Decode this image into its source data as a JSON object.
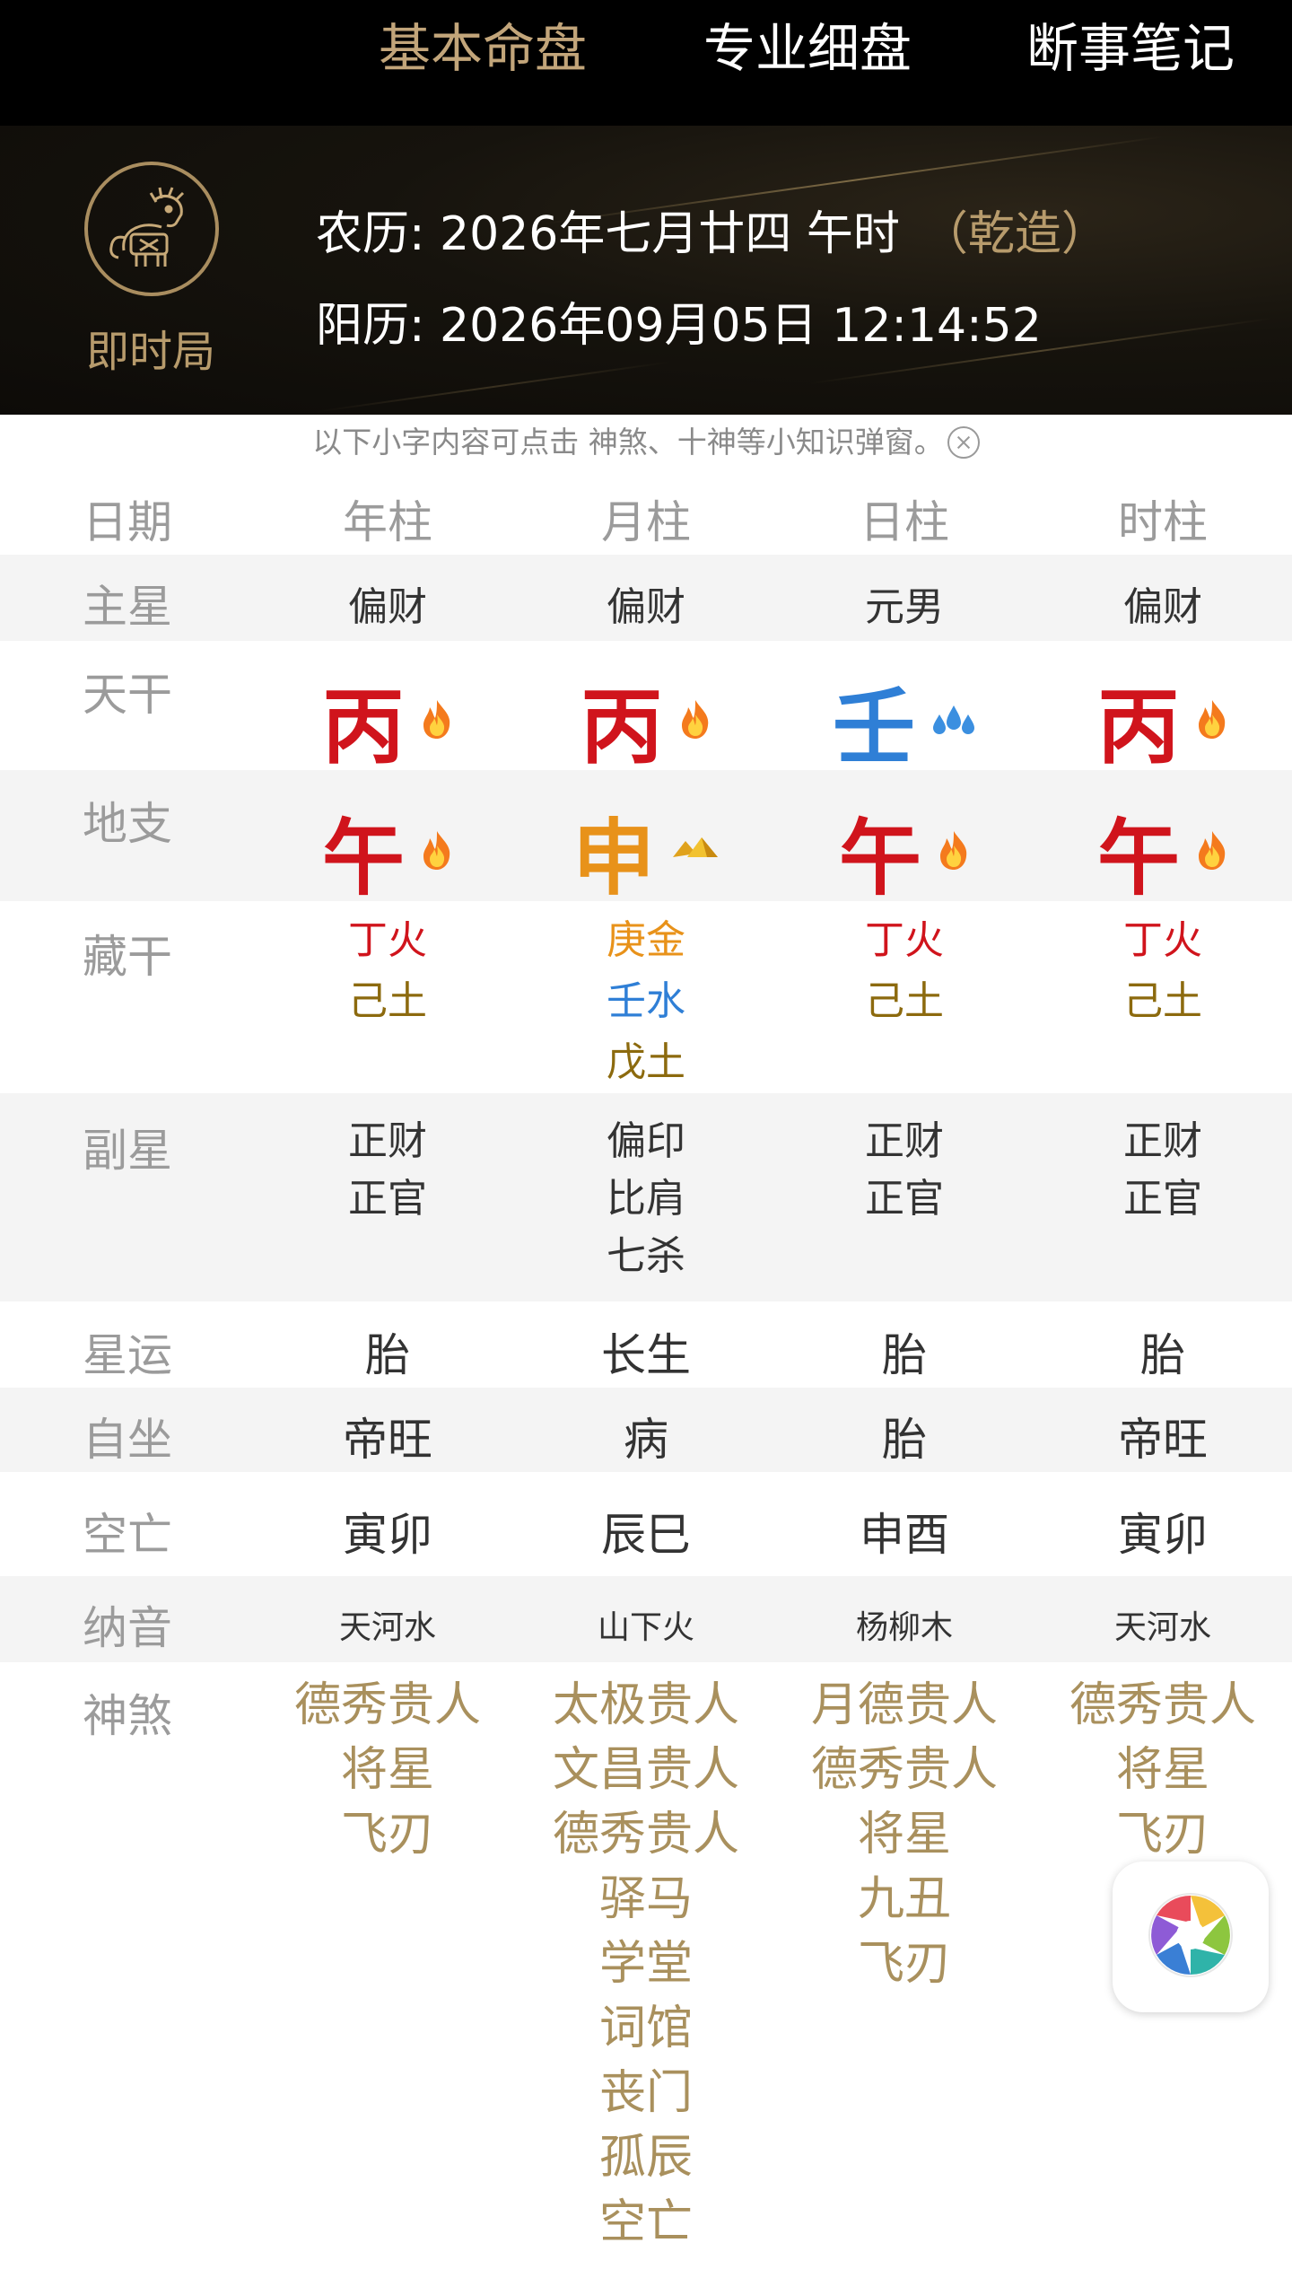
{
  "tabs": [
    {
      "label": "基本命盘",
      "active": true
    },
    {
      "label": "专业细盘",
      "active": false
    },
    {
      "label": "断事笔记",
      "active": false
    }
  ],
  "header": {
    "logo_label": "即时局",
    "lunar": "农历: 2026年七月廿四 午时",
    "gender": "（乾造）",
    "solar": "阳历: 2026年09月05日 12:14:52"
  },
  "hint": "以下小字内容可点击 神煞、十神等小知识弹窗。",
  "colors": {
    "fire": "#d0141c",
    "water": "#2f7fd6",
    "metal": "#e8921a",
    "earth": "#8c6a0e",
    "gold": "#b79b6c",
    "shensha": "#a9905d"
  },
  "table": {
    "labels": {
      "date": "日期",
      "main_star": "主星",
      "tiangan": "天干",
      "dizhi": "地支",
      "canggan": "藏干",
      "fuxing": "副星",
      "xingyun": "星运",
      "zizuo": "自坐",
      "kongwang": "空亡",
      "nayin": "纳音",
      "shensha": "神煞"
    },
    "pillars": [
      {
        "name": "年柱",
        "main_star": "偏财",
        "gan": "丙",
        "gan_element": "fire",
        "gan_icon": "fire-icon",
        "zhi": "午",
        "zhi_element": "fire",
        "zhi_icon": "fire-icon",
        "canggan": [
          {
            "text": "丁火",
            "element": "fire"
          },
          {
            "text": "己土",
            "element": "earth"
          }
        ],
        "fuxing": [
          "正财",
          "正官"
        ],
        "xingyun": "胎",
        "zizuo": "帝旺",
        "kongwang": "寅卯",
        "nayin": "天河水",
        "shensha": [
          "德秀贵人",
          "将星",
          "飞刃"
        ]
      },
      {
        "name": "月柱",
        "main_star": "偏财",
        "gan": "丙",
        "gan_element": "fire",
        "gan_icon": "fire-icon",
        "zhi": "申",
        "zhi_element": "metal",
        "zhi_icon": "gold-ingot-icon",
        "canggan": [
          {
            "text": "庚金",
            "element": "metal"
          },
          {
            "text": "壬水",
            "element": "water"
          },
          {
            "text": "戊土",
            "element": "earth"
          }
        ],
        "fuxing": [
          "偏印",
          "比肩",
          "七杀"
        ],
        "xingyun": "长生",
        "zizuo": "病",
        "kongwang": "辰巳",
        "nayin": "山下火",
        "shensha": [
          "太极贵人",
          "文昌贵人",
          "德秀贵人",
          "驿马",
          "学堂",
          "词馆",
          "丧门",
          "孤辰",
          "空亡"
        ]
      },
      {
        "name": "日柱",
        "main_star": "元男",
        "gan": "壬",
        "gan_element": "water",
        "gan_icon": "water-drops-icon",
        "zhi": "午",
        "zhi_element": "fire",
        "zhi_icon": "fire-icon",
        "canggan": [
          {
            "text": "丁火",
            "element": "fire"
          },
          {
            "text": "己土",
            "element": "earth"
          }
        ],
        "fuxing": [
          "正财",
          "正官"
        ],
        "xingyun": "胎",
        "zizuo": "胎",
        "kongwang": "申酉",
        "nayin": "杨柳木",
        "shensha": [
          "月德贵人",
          "德秀贵人",
          "将星",
          "九丑",
          "飞刃"
        ]
      },
      {
        "name": "时柱",
        "main_star": "偏财",
        "gan": "丙",
        "gan_element": "fire",
        "gan_icon": "fire-icon",
        "zhi": "午",
        "zhi_element": "fire",
        "zhi_icon": "fire-icon",
        "canggan": [
          {
            "text": "丁火",
            "element": "fire"
          },
          {
            "text": "己土",
            "element": "earth"
          }
        ],
        "fuxing": [
          "正财",
          "正官"
        ],
        "xingyun": "胎",
        "zizuo": "帝旺",
        "kongwang": "寅卯",
        "nayin": "天河水",
        "shensha": [
          "德秀贵人",
          "将星",
          "飞刃"
        ]
      }
    ]
  },
  "floating_button_icon": "camera-shutter-icon"
}
